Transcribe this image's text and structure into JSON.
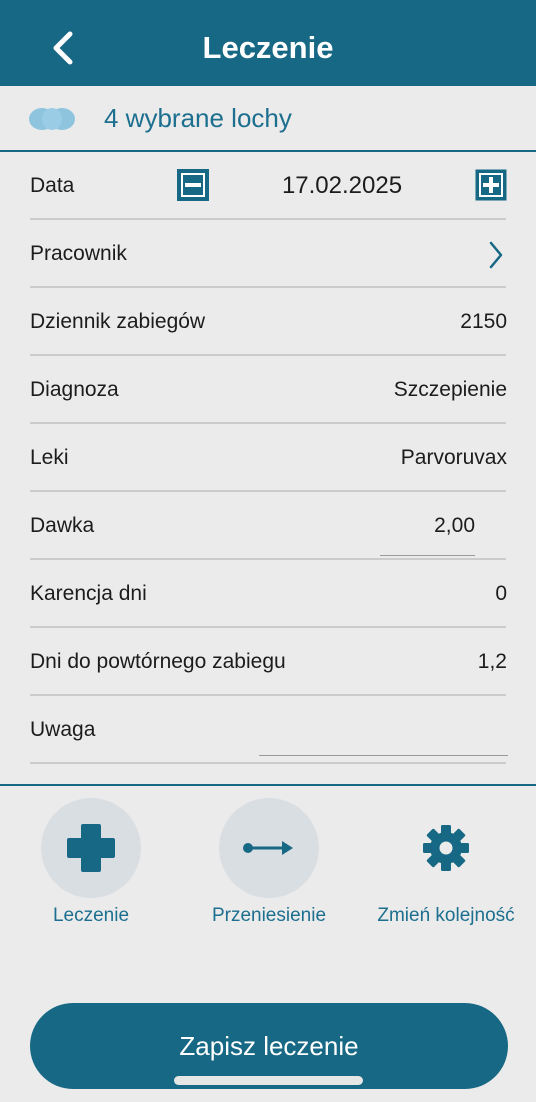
{
  "header": {
    "title": "Leczenie",
    "back_icon": "chevron-left-icon"
  },
  "selection": {
    "text": "4 wybrane lochy",
    "icon": "sows-group-icon"
  },
  "form": {
    "date": {
      "label": "Data",
      "value": "17.02.2025"
    },
    "worker": {
      "label": "Pracownik"
    },
    "log": {
      "label": "Dziennik zabiegów",
      "value": "2150"
    },
    "diagnosis": {
      "label": "Diagnoza",
      "value": "Szczepienie"
    },
    "drugs": {
      "label": "Leki",
      "value": "Parvoruvax"
    },
    "dose": {
      "label": "Dawka",
      "value": "2,00"
    },
    "withdrawal": {
      "label": "Karencja dni",
      "value": "0"
    },
    "repeat": {
      "label": "Dni do powtórnego zabiegu",
      "value": "1,2"
    },
    "note": {
      "label": "Uwaga",
      "value": ""
    }
  },
  "actions": [
    {
      "label": "Leczenie",
      "icon": "plus-cross-icon"
    },
    {
      "label": "Przeniesienie",
      "icon": "transfer-arrow-icon"
    },
    {
      "label": "Zmień kolejność",
      "icon": "gear-icon"
    }
  ],
  "save_button": {
    "label": "Zapisz leczenie"
  },
  "colors": {
    "primary": "#176884",
    "accent_text": "#1c6f8e",
    "background": "#ebebeb",
    "circle": "#d9dee3"
  }
}
